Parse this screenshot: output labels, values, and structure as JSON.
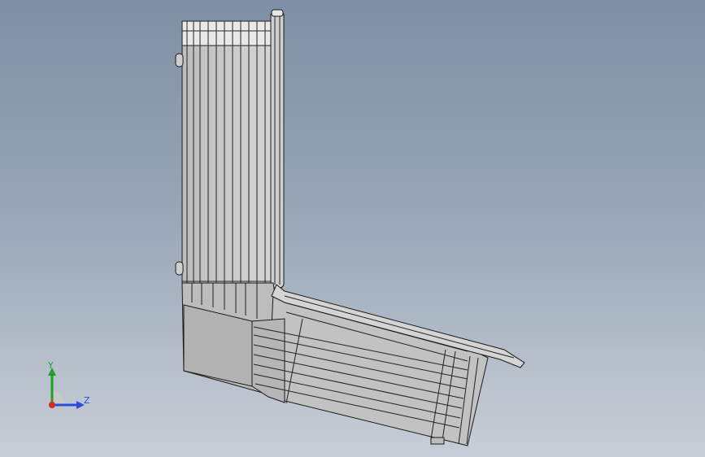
{
  "triad": {
    "y_label": "Y",
    "z_label": "Z",
    "y_color": "#1fa02b",
    "z_color": "#2a4fd6",
    "x_color": "#d22a2a"
  },
  "colors": {
    "viewport_top": "#7f8fa5",
    "viewport_bottom": "#c8ced6",
    "part_face": "#c4c4c4",
    "part_edge": "#1a1a1a"
  }
}
